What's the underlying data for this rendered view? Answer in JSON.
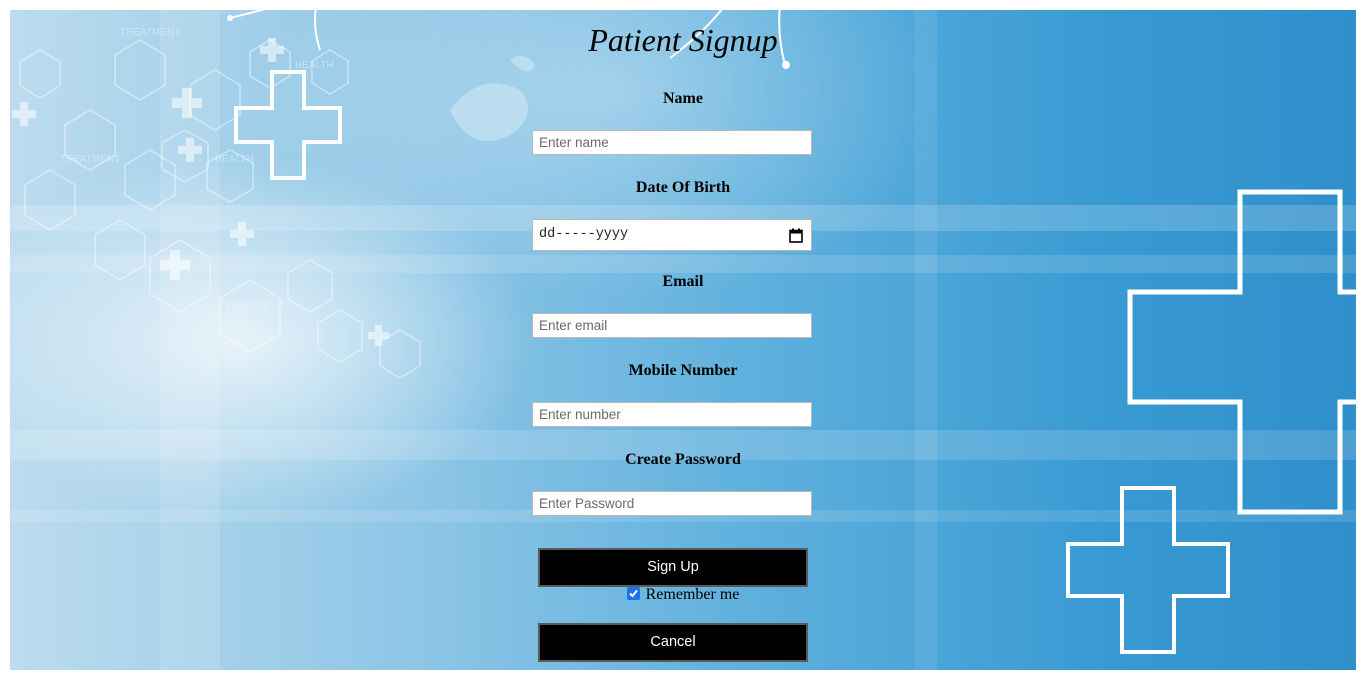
{
  "form": {
    "title": "Patient Signup",
    "name": {
      "label": "Name",
      "placeholder": "Enter name"
    },
    "dob": {
      "label": "Date Of Birth",
      "value": "dd-----yyyy"
    },
    "email": {
      "label": "Email",
      "placeholder": "Enter email"
    },
    "mobile": {
      "label": "Mobile Number",
      "placeholder": "Enter number"
    },
    "password": {
      "label": "Create Password",
      "placeholder": "Enter Password"
    },
    "signup_label": "Sign Up",
    "remember_label": "Remember me",
    "remember_checked": true,
    "cancel_label": "Cancel"
  },
  "colors": {
    "button_bg": "#000000",
    "checkbox_accent": "#1a73e8",
    "background_accent": "#3a9bd3"
  },
  "icons": [
    "calendar-icon",
    "checkmark-icon",
    "medical-cross-icon"
  ]
}
